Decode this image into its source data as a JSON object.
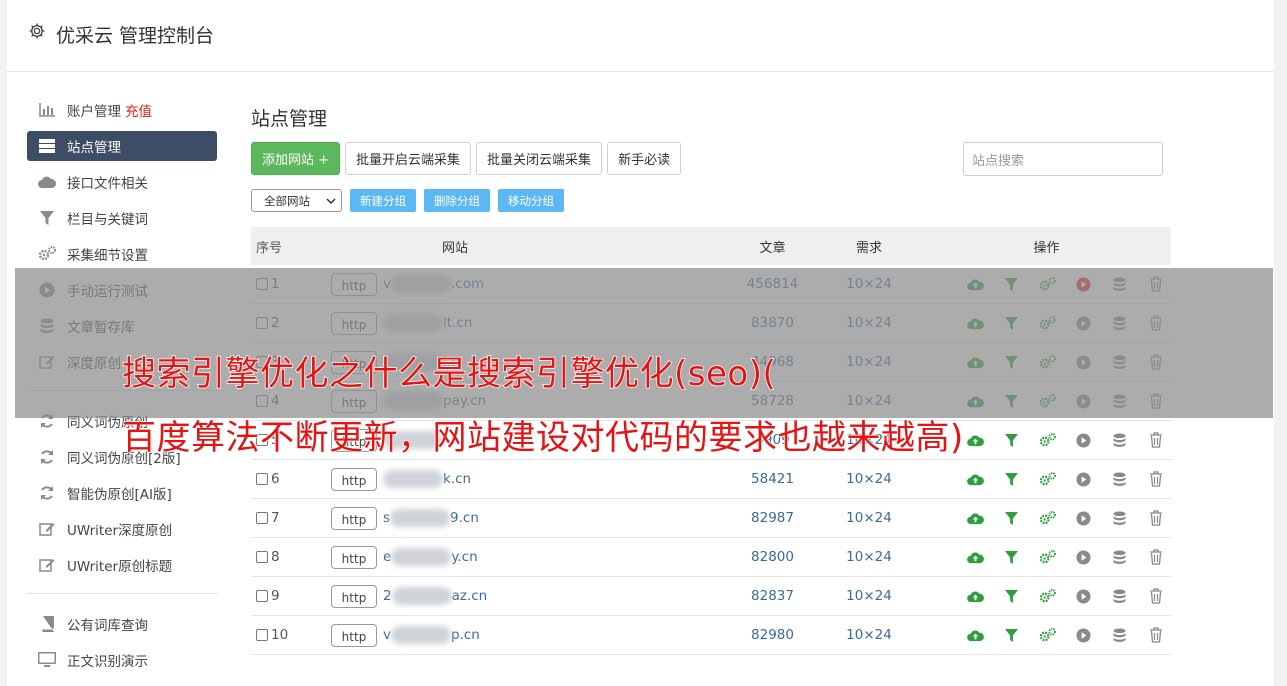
{
  "app": {
    "title": "优采云 管理控制台"
  },
  "sidebar": {
    "items": [
      {
        "label": "账户管理",
        "badge": "充值",
        "icon": "bar-chart-icon"
      },
      {
        "label": "站点管理",
        "icon": "server-icon",
        "active": true
      },
      {
        "label": "接口文件相关",
        "icon": "cloud-icon"
      },
      {
        "label": "栏目与关键词",
        "icon": "filter-icon"
      },
      {
        "label": "采集细节设置",
        "icon": "cogs-icon"
      },
      {
        "label": "手动运行测试",
        "icon": "play-icon"
      },
      {
        "label": "文章暂存库",
        "icon": "database-icon"
      },
      {
        "label": "深度原创",
        "icon": "edit-icon"
      }
    ],
    "items2": [
      {
        "label": "同义词伪原创",
        "icon": "refresh-icon"
      },
      {
        "label": "同义词伪原创[2版]",
        "icon": "refresh-icon"
      },
      {
        "label": "智能伪原创[AI版]",
        "icon": "refresh-icon"
      },
      {
        "label": "UWriter深度原创",
        "icon": "edit-icon"
      },
      {
        "label": "UWriter原创标题",
        "icon": "edit-icon"
      }
    ],
    "items3": [
      {
        "label": "公有词库查询",
        "icon": "book-icon"
      },
      {
        "label": "正文识别演示",
        "icon": "monitor-icon"
      }
    ]
  },
  "main": {
    "title": "站点管理",
    "toolbar": {
      "add": "添加网站 +",
      "batch_open": "批量开启云端采集",
      "batch_close": "批量关闭云端采集",
      "guide": "新手必读"
    },
    "search_placeholder": "站点搜索",
    "filter": {
      "selected": "全部网站",
      "new_group": "新建分组",
      "delete_group": "删除分组",
      "move_group": "移动分组"
    },
    "table": {
      "headers": [
        "序号",
        "网站",
        "文章",
        "需求",
        "操作"
      ],
      "rows": [
        {
          "no": "1",
          "proto": "http",
          "domain": "v",
          "suffix": ".com",
          "articles": "456814",
          "req": "10×24",
          "play_red": true
        },
        {
          "no": "2",
          "proto": "http",
          "domain": "",
          "suffix": "lt.cn",
          "articles": "83870",
          "req": "10×24"
        },
        {
          "no": "3",
          "proto": "http",
          "domain": "",
          "suffix": "i.n",
          "articles": "44968",
          "req": "10×24"
        },
        {
          "no": "4",
          "proto": "http",
          "domain": "",
          "suffix": "pay.cn",
          "articles": "58728",
          "req": "10×24"
        },
        {
          "no": "5",
          "proto": "http",
          "domain": "",
          "suffix": "",
          "articles": "4909",
          "req": "10×24"
        },
        {
          "no": "6",
          "proto": "http",
          "domain": "",
          "suffix": "k.cn",
          "articles": "58421",
          "req": "10×24"
        },
        {
          "no": "7",
          "proto": "http",
          "domain": "s",
          "suffix": "9.cn",
          "articles": "82987",
          "req": "10×24"
        },
        {
          "no": "8",
          "proto": "http",
          "domain": "e",
          "suffix": "y.cn",
          "articles": "82800",
          "req": "10×24"
        },
        {
          "no": "9",
          "proto": "http",
          "domain": "2",
          "suffix": "az.cn",
          "articles": "82837",
          "req": "10×24"
        },
        {
          "no": "10",
          "proto": "http",
          "domain": "v",
          "suffix": "p.cn",
          "articles": "82980",
          "req": "10×24"
        }
      ]
    }
  },
  "overlay": {
    "line1": "搜索引擎优化之什么是搜索引擎优化(seo)(",
    "line2": "百度算法不断更新，网站建设对代码的要求也越来越高)"
  },
  "colors": {
    "active_sidebar": "#3d4d65",
    "green": "#5cb85c",
    "blue_btn": "#5bb8f5",
    "overlay_red": "#e41414"
  }
}
